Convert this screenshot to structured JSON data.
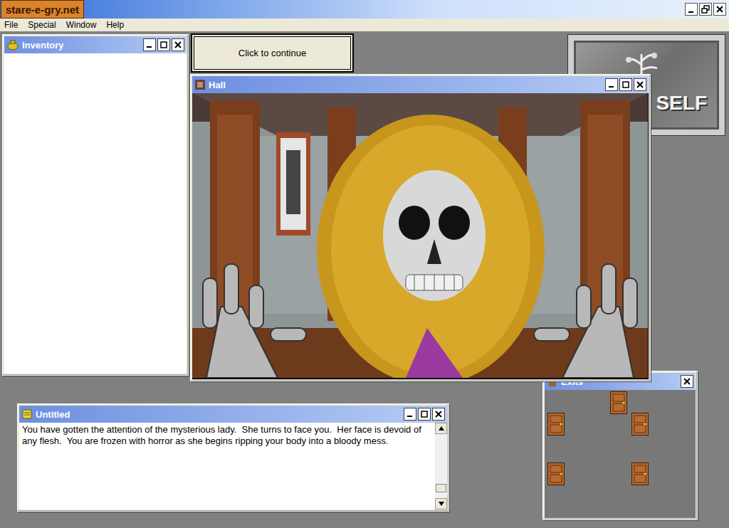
{
  "title_bar": {
    "logo": "stare-e-gry.net"
  },
  "menu": [
    {
      "label": "File"
    },
    {
      "label": "Special"
    },
    {
      "label": "Window"
    },
    {
      "label": "Help"
    }
  ],
  "inventory": {
    "title": "Inventory",
    "items": []
  },
  "continue_button": {
    "label": "Click to continue"
  },
  "self_button": {
    "label": "SELF"
  },
  "scene": {
    "title": "Hall"
  },
  "text_window": {
    "title": "Untitled",
    "text": "You have gotten the attention of the mysterious lady.  She turns to face you.  Her face is devoid of any flesh.  You are frozen with horror as she begins ripping your body into a bloody mess.",
    "scroll_level": 0.95
  },
  "exits": {
    "title": "Exits"
  }
}
